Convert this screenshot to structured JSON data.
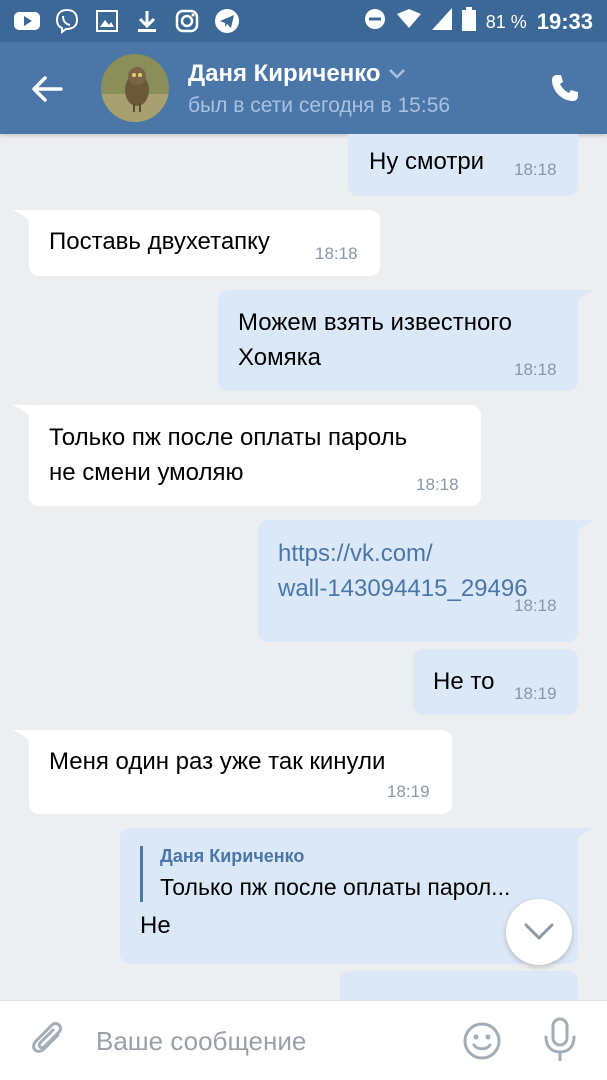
{
  "status_bar": {
    "battery_percent": "81 %",
    "time": "19:33",
    "left_icons": [
      "youtube-icon",
      "viber-icon",
      "gallery-icon",
      "download-icon",
      "instagram-icon",
      "telegram-icon"
    ],
    "right_icons": [
      "dnd-icon",
      "wifi-icon",
      "signal-icon",
      "battery-icon"
    ]
  },
  "header": {
    "contact_name": "Даня Кириченко",
    "contact_status": "был в сети сегодня в 15:56",
    "bg_color": "#4a76a8"
  },
  "messages": [
    {
      "dir": "out",
      "text": "Ну смотри",
      "time": "18:18"
    },
    {
      "dir": "in",
      "text": "Поставь двухетапку",
      "time": "18:18"
    },
    {
      "dir": "out",
      "lines": [
        "Можем взять известного",
        "Хомяка"
      ],
      "time": "18:18"
    },
    {
      "dir": "in",
      "lines": [
        "Только пж после оплаты пароль",
        "не смени умоляю"
      ],
      "time": "18:18"
    },
    {
      "dir": "out",
      "lines": [
        "https://vk.com/",
        "wall-143094415_29496"
      ],
      "time": "18:18",
      "is_link": true
    },
    {
      "dir": "out",
      "text": "Не то",
      "time": "18:19"
    },
    {
      "dir": "in",
      "text": "Меня один раз уже так кинули",
      "time": "18:19"
    },
    {
      "dir": "out",
      "reply": {
        "name": "Даня Кириченко",
        "text": "Только пж после оплаты парол..."
      },
      "text": "Не"
    }
  ],
  "input": {
    "placeholder": "Ваше сообщение"
  },
  "colors": {
    "incoming_bubble": "#ffffff",
    "outgoing_bubble": "#dbe8f7",
    "accent": "#4a76a8"
  }
}
